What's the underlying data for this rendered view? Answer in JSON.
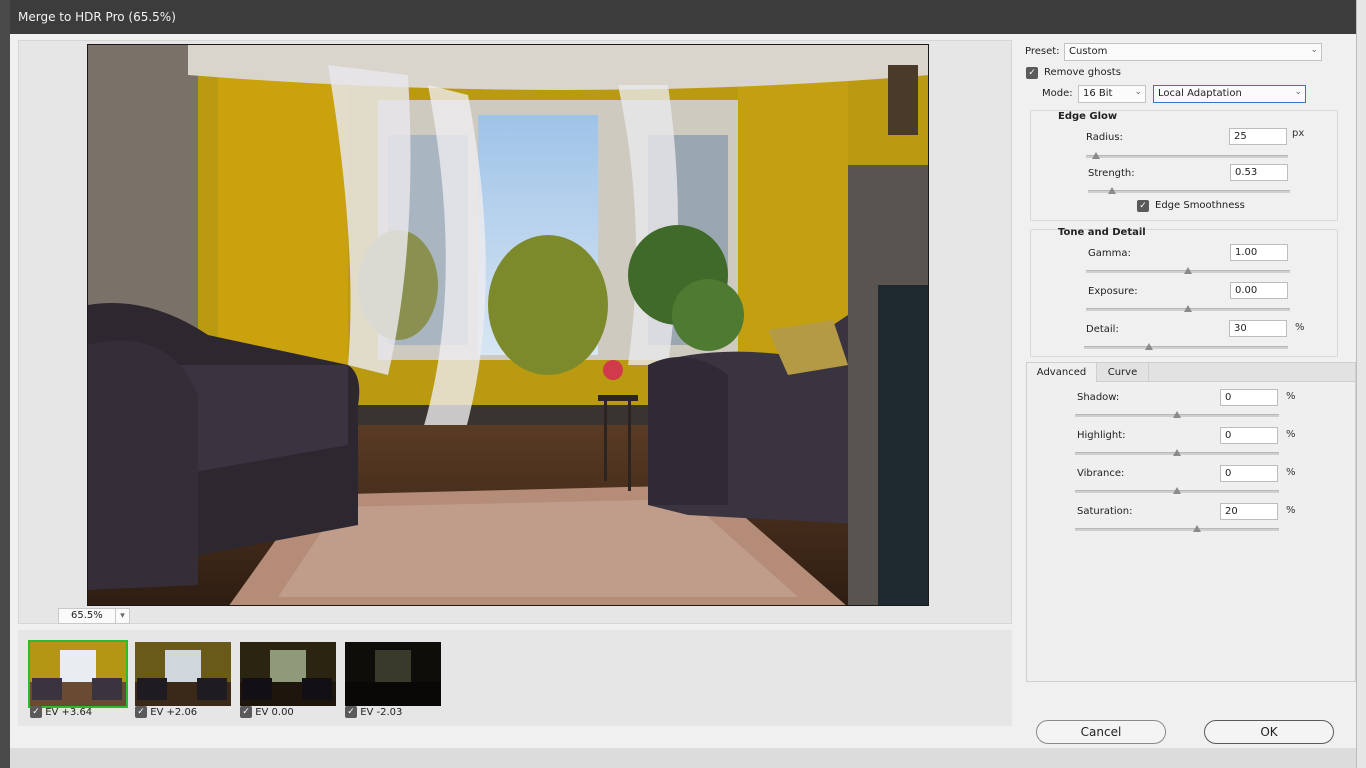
{
  "dialog": {
    "title": "Merge to HDR Pro (65.5%)"
  },
  "preview": {
    "zoom": "65.5%"
  },
  "thumbnails": [
    {
      "label": "EV +3.64",
      "checked": true,
      "selected": true
    },
    {
      "label": "EV +2.06",
      "checked": true,
      "selected": false
    },
    {
      "label": "EV 0.00",
      "checked": true,
      "selected": false
    },
    {
      "label": "EV -2.03",
      "checked": true,
      "selected": false
    }
  ],
  "panel": {
    "preset_label": "Preset:",
    "preset_value": "Custom",
    "remove_ghosts_label": "Remove ghosts",
    "mode_label": "Mode:",
    "bit_depth": "16 Bit",
    "method": "Local Adaptation",
    "edge_glow": {
      "title": "Edge Glow",
      "radius_label": "Radius:",
      "radius_value": "25",
      "radius_unit": "px",
      "radius_fraction": 0.05,
      "strength_label": "Strength:",
      "strength_value": "0.53",
      "strength_fraction": 0.12,
      "edge_smoothness_label": "Edge Smoothness"
    },
    "tone_detail": {
      "title": "Tone and Detail",
      "gamma_label": "Gamma:",
      "gamma_value": "1.00",
      "gamma_fraction": 0.5,
      "exposure_label": "Exposure:",
      "exposure_value": "0.00",
      "exposure_fraction": 0.5,
      "detail_label": "Detail:",
      "detail_value": "30",
      "detail_unit": "%",
      "detail_fraction": 0.32
    },
    "tabs": {
      "advanced": "Advanced",
      "curve": "Curve"
    },
    "advanced": {
      "shadow_label": "Shadow:",
      "shadow_value": "0",
      "shadow_fraction": 0.5,
      "highlight_label": "Highlight:",
      "highlight_value": "0",
      "highlight_fraction": 0.5,
      "vibrance_label": "Vibrance:",
      "vibrance_value": "0",
      "vibrance_fraction": 0.5,
      "saturation_label": "Saturation:",
      "saturation_value": "20",
      "saturation_fraction": 0.6,
      "unit": "%"
    }
  },
  "buttons": {
    "cancel": "Cancel",
    "ok": "OK"
  }
}
